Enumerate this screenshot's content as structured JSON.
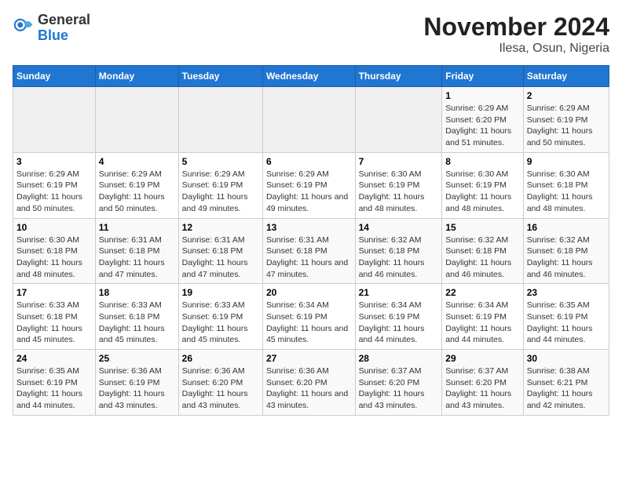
{
  "logo": {
    "general": "General",
    "blue": "Blue"
  },
  "title": "November 2024",
  "subtitle": "Ilesa, Osun, Nigeria",
  "headers": [
    "Sunday",
    "Monday",
    "Tuesday",
    "Wednesday",
    "Thursday",
    "Friday",
    "Saturday"
  ],
  "weeks": [
    {
      "days": [
        {
          "num": "",
          "info": "",
          "empty": true
        },
        {
          "num": "",
          "info": "",
          "empty": true
        },
        {
          "num": "",
          "info": "",
          "empty": true
        },
        {
          "num": "",
          "info": "",
          "empty": true
        },
        {
          "num": "",
          "info": "",
          "empty": true
        },
        {
          "num": "1",
          "info": "Sunrise: 6:29 AM\nSunset: 6:20 PM\nDaylight: 11 hours and 51 minutes."
        },
        {
          "num": "2",
          "info": "Sunrise: 6:29 AM\nSunset: 6:19 PM\nDaylight: 11 hours and 50 minutes."
        }
      ]
    },
    {
      "days": [
        {
          "num": "3",
          "info": "Sunrise: 6:29 AM\nSunset: 6:19 PM\nDaylight: 11 hours and 50 minutes."
        },
        {
          "num": "4",
          "info": "Sunrise: 6:29 AM\nSunset: 6:19 PM\nDaylight: 11 hours and 50 minutes."
        },
        {
          "num": "5",
          "info": "Sunrise: 6:29 AM\nSunset: 6:19 PM\nDaylight: 11 hours and 49 minutes."
        },
        {
          "num": "6",
          "info": "Sunrise: 6:29 AM\nSunset: 6:19 PM\nDaylight: 11 hours and 49 minutes."
        },
        {
          "num": "7",
          "info": "Sunrise: 6:30 AM\nSunset: 6:19 PM\nDaylight: 11 hours and 48 minutes."
        },
        {
          "num": "8",
          "info": "Sunrise: 6:30 AM\nSunset: 6:19 PM\nDaylight: 11 hours and 48 minutes."
        },
        {
          "num": "9",
          "info": "Sunrise: 6:30 AM\nSunset: 6:18 PM\nDaylight: 11 hours and 48 minutes."
        }
      ]
    },
    {
      "days": [
        {
          "num": "10",
          "info": "Sunrise: 6:30 AM\nSunset: 6:18 PM\nDaylight: 11 hours and 48 minutes."
        },
        {
          "num": "11",
          "info": "Sunrise: 6:31 AM\nSunset: 6:18 PM\nDaylight: 11 hours and 47 minutes."
        },
        {
          "num": "12",
          "info": "Sunrise: 6:31 AM\nSunset: 6:18 PM\nDaylight: 11 hours and 47 minutes."
        },
        {
          "num": "13",
          "info": "Sunrise: 6:31 AM\nSunset: 6:18 PM\nDaylight: 11 hours and 47 minutes."
        },
        {
          "num": "14",
          "info": "Sunrise: 6:32 AM\nSunset: 6:18 PM\nDaylight: 11 hours and 46 minutes."
        },
        {
          "num": "15",
          "info": "Sunrise: 6:32 AM\nSunset: 6:18 PM\nDaylight: 11 hours and 46 minutes."
        },
        {
          "num": "16",
          "info": "Sunrise: 6:32 AM\nSunset: 6:18 PM\nDaylight: 11 hours and 46 minutes."
        }
      ]
    },
    {
      "days": [
        {
          "num": "17",
          "info": "Sunrise: 6:33 AM\nSunset: 6:18 PM\nDaylight: 11 hours and 45 minutes."
        },
        {
          "num": "18",
          "info": "Sunrise: 6:33 AM\nSunset: 6:18 PM\nDaylight: 11 hours and 45 minutes."
        },
        {
          "num": "19",
          "info": "Sunrise: 6:33 AM\nSunset: 6:19 PM\nDaylight: 11 hours and 45 minutes."
        },
        {
          "num": "20",
          "info": "Sunrise: 6:34 AM\nSunset: 6:19 PM\nDaylight: 11 hours and 45 minutes."
        },
        {
          "num": "21",
          "info": "Sunrise: 6:34 AM\nSunset: 6:19 PM\nDaylight: 11 hours and 44 minutes."
        },
        {
          "num": "22",
          "info": "Sunrise: 6:34 AM\nSunset: 6:19 PM\nDaylight: 11 hours and 44 minutes."
        },
        {
          "num": "23",
          "info": "Sunrise: 6:35 AM\nSunset: 6:19 PM\nDaylight: 11 hours and 44 minutes."
        }
      ]
    },
    {
      "days": [
        {
          "num": "24",
          "info": "Sunrise: 6:35 AM\nSunset: 6:19 PM\nDaylight: 11 hours and 44 minutes."
        },
        {
          "num": "25",
          "info": "Sunrise: 6:36 AM\nSunset: 6:19 PM\nDaylight: 11 hours and 43 minutes."
        },
        {
          "num": "26",
          "info": "Sunrise: 6:36 AM\nSunset: 6:20 PM\nDaylight: 11 hours and 43 minutes."
        },
        {
          "num": "27",
          "info": "Sunrise: 6:36 AM\nSunset: 6:20 PM\nDaylight: 11 hours and 43 minutes."
        },
        {
          "num": "28",
          "info": "Sunrise: 6:37 AM\nSunset: 6:20 PM\nDaylight: 11 hours and 43 minutes."
        },
        {
          "num": "29",
          "info": "Sunrise: 6:37 AM\nSunset: 6:20 PM\nDaylight: 11 hours and 43 minutes."
        },
        {
          "num": "30",
          "info": "Sunrise: 6:38 AM\nSunset: 6:21 PM\nDaylight: 11 hours and 42 minutes."
        }
      ]
    }
  ]
}
